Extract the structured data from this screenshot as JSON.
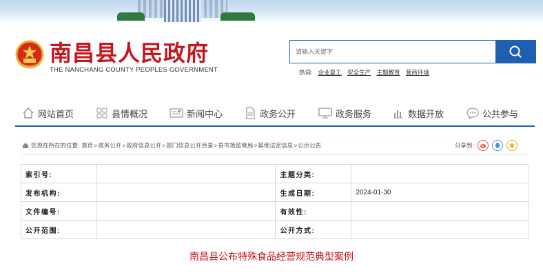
{
  "header": {
    "title": "南昌县人民政府",
    "subtitle": "THE NANCHANG COUNTY PEOPLES GOVERNMENT"
  },
  "search": {
    "placeholder": "请输入关键字",
    "hot_label": "热词:",
    "hot_words": [
      "企业复工",
      "安全生产",
      "主题教育",
      "营商环境"
    ]
  },
  "nav": {
    "items": [
      {
        "label": "网站首页",
        "icon": "home-icon"
      },
      {
        "label": "县情概况",
        "icon": "grid-icon"
      },
      {
        "label": "新闻中心",
        "icon": "news-icon"
      },
      {
        "label": "政务公开",
        "icon": "document-icon"
      },
      {
        "label": "政务服务",
        "icon": "monitor-icon"
      },
      {
        "label": "数据开放",
        "icon": "bar-chart-icon"
      },
      {
        "label": "公共参与",
        "icon": "chat-icon"
      }
    ]
  },
  "breadcrumb": {
    "prefix": "您现在所在的位置:",
    "items": [
      "首页",
      "政务公开",
      "政府信息公开",
      "部门信息公开目录",
      "县市场监管局",
      "其他法定信息",
      "公示公告"
    ]
  },
  "share": {
    "label": "分享到:",
    "icons": [
      "weibo-icon",
      "qq-icon",
      "qzone-icon"
    ]
  },
  "meta_table": {
    "rows": [
      {
        "k1": "索引号:",
        "v1": "",
        "k2": "主题分类:",
        "v2": ""
      },
      {
        "k1": "发布机构:",
        "v1": "",
        "k2": "生成日期:",
        "v2": "2024-01-30"
      },
      {
        "k1": "文件编号:",
        "v1": "",
        "k2": "有效性:",
        "v2": ""
      },
      {
        "k1": "公开范围:",
        "v1": "",
        "k2": "公开方式:",
        "v2": ""
      }
    ]
  },
  "article": {
    "title": "南昌县公布特殊食品经营规范典型案例"
  },
  "colors": {
    "brand_red": "#c4161c",
    "brand_blue": "#1f5fb2"
  }
}
